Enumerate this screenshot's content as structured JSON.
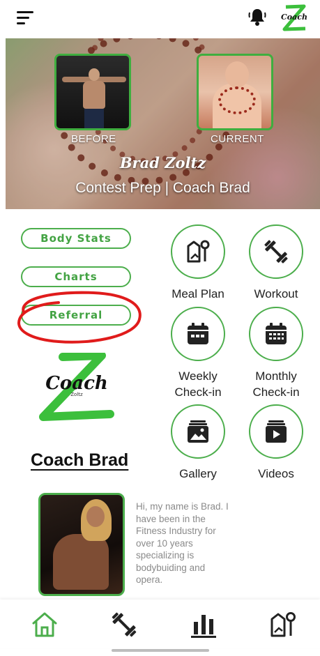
{
  "hero": {
    "before_label": "BEFORE",
    "current_label": "CURRENT",
    "name": "Brad Zoltz",
    "subtitle": "Contest Prep | Coach Brad"
  },
  "left_menu": [
    {
      "label": "Body Stats"
    },
    {
      "label": "Charts"
    },
    {
      "label": "Referral"
    }
  ],
  "logo": {
    "text": "Coach",
    "subtext": "Zoltz"
  },
  "coach_title": "Coach Brad",
  "tiles": [
    {
      "label": "Meal Plan",
      "icon": "meal-plan-icon"
    },
    {
      "label": "Workout",
      "icon": "dumbbell-icon"
    },
    {
      "label": "Weekly\nCheck-in",
      "icon": "calendar-week-icon"
    },
    {
      "label": "Monthly\nCheck-in",
      "icon": "calendar-month-icon"
    },
    {
      "label": "Gallery",
      "icon": "gallery-icon"
    },
    {
      "label": "Videos",
      "icon": "videos-icon"
    }
  ],
  "bio": {
    "text": "Hi, my name is Brad. I have been in the Fitness Industry for over 10 years specializing is bodybuiding and opera."
  },
  "bottom_nav": [
    {
      "icon": "home-icon",
      "active": true
    },
    {
      "icon": "dumbbell-icon"
    },
    {
      "icon": "bar-chart-icon"
    },
    {
      "icon": "meal-plan-icon"
    }
  ],
  "colors": {
    "accent": "#4cae4c",
    "annotation": "#e01b1b"
  }
}
